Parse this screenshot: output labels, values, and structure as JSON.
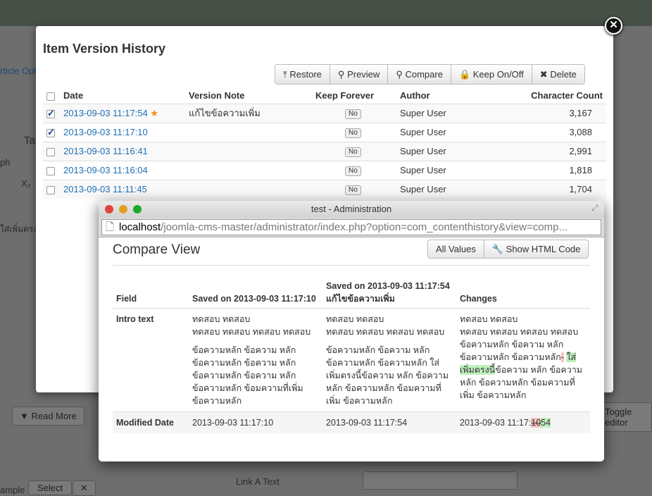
{
  "background": {
    "article_options": "rticle Opt",
    "tab_fragment": "Ta",
    "paragraph_fragment": "ph",
    "subscript": "X₂",
    "thai_fragment": "ใส่เพิ่มตรง",
    "read_more": "Read More",
    "toggle_editor": "Toggle editor",
    "example_fragment": "ample",
    "select": "Select",
    "clear": "✕",
    "link_a_text": "Link A Text"
  },
  "modal": {
    "title": "Item Version History",
    "close": "✕",
    "toolbar": [
      {
        "icon": "upload-icon",
        "glyph": "⤒",
        "label": "Restore"
      },
      {
        "icon": "search-icon",
        "glyph": "⚲",
        "label": "Preview"
      },
      {
        "icon": "zoom-icon",
        "glyph": "⚲",
        "label": "Compare"
      },
      {
        "icon": "lock-icon",
        "glyph": "🔒",
        "label": "Keep On/Off"
      },
      {
        "icon": "close-icon",
        "glyph": "✖",
        "label": "Delete"
      }
    ],
    "columns": [
      "Date",
      "Version Note",
      "Keep Forever",
      "Author",
      "Character Count"
    ],
    "rows": [
      {
        "checked": true,
        "date": "2013-09-03 11:17:54",
        "current": true,
        "note": "แก้ไขข้อความเพิ่ม",
        "keep": "No",
        "author": "Super User",
        "count": "3,167"
      },
      {
        "checked": true,
        "date": "2013-09-03 11:17:10",
        "current": false,
        "note": "",
        "keep": "No",
        "author": "Super User",
        "count": "3,088"
      },
      {
        "checked": false,
        "date": "2013-09-03 11:16:41",
        "current": false,
        "note": "",
        "keep": "No",
        "author": "Super User",
        "count": "2,991"
      },
      {
        "checked": false,
        "date": "2013-09-03 11:16:04",
        "current": false,
        "note": "",
        "keep": "No",
        "author": "Super User",
        "count": "1,818"
      },
      {
        "checked": false,
        "date": "2013-09-03 11:11:45",
        "current": false,
        "note": "",
        "keep": "No",
        "author": "Super User",
        "count": "1,704"
      }
    ]
  },
  "popup": {
    "window_title": "test - Administration",
    "url_host": "localhost",
    "url_path": "/joomla-cms-master/administrator/index.php?option=com_contenthistory&view=comp...",
    "title": "Compare View",
    "buttons": {
      "all_values": "All Values",
      "show_html": "Show HTML Code"
    },
    "headers": {
      "field": "Field",
      "saved1": "Saved on 2013-09-03 11:17:10",
      "saved2": "Saved on 2013-09-03 11:17:54 แก้ไขข้อความเพิ่ม",
      "changes": "Changes"
    },
    "intro": {
      "label": "Intro text",
      "v1_p1a": "ทดสอบ ทดสอบ",
      "v1_p1b": " ทดสอบ ทดสอบ ทดสอบ ทดสอบ",
      "v1_p2": "ข้อความหลัก ข้อความ หลัก ข้อความหลัก ข้อความ หลัก ข้อความหลัก ข้อความ หลัก ข้อความหลัก ข้อมความที่เพิ่ม ข้อความหลัก",
      "v2_p1a": "ทดสอบ ทดสอบ",
      "v2_p1b": " ทดสอบ ทดสอบ ทดสอบ ทดสอบ",
      "v2_p2": "ข้อความหลัก ข้อความ หลัก ข้อความหลัก ข้อความหลัก ใส่เพิ่มตรงนี้ข้อความ หลัก ข้อความหลัก ข้อความหลัก ข้อมความที่เพิ่ม ข้อความหลัก",
      "c_a": "ทดสอบ ทดสอบ",
      "c_b": " ทดสอบ ทดสอบ ทดสอบ ทดสอบ",
      "c_c": "ข้อความหลัก ข้อความ หลัก ข้อความหลัก ข้อความหลัก",
      "c_del": "-",
      "c_ins": "ใส่เพิ่มตรงนี้",
      "c_rest": "ข้อความ หลัก ข้อความหลัก ข้อความหลัก ข้อมความที่เพิ่ม ข้อความหลัก"
    },
    "modified": {
      "label": "Modified Date",
      "v1": "2013-09-03 11:17:10",
      "v2": "2013-09-03 11:17:54",
      "c_prefix": "2013-09-03 11:17:",
      "c_del": "10",
      "c_ins": "54"
    }
  }
}
